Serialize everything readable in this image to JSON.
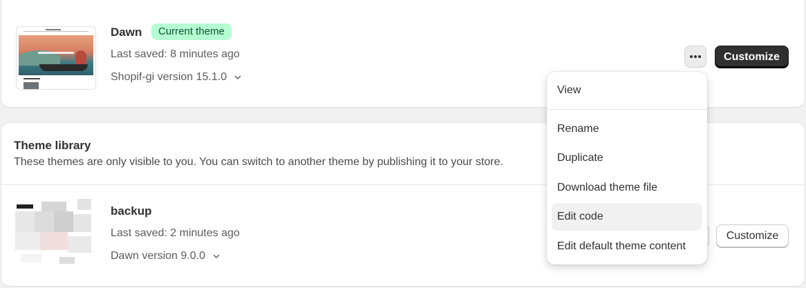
{
  "current_theme": {
    "name": "Dawn",
    "badge": "Current theme",
    "last_saved": "Last saved: 8 minutes ago",
    "version": "Shopif-gi version 15.1.0",
    "actions_icon": "more-horizontal-icon",
    "customize_label": "Customize"
  },
  "theme_library": {
    "title": "Theme library",
    "subtitle": "These themes are only visible to you. You can switch to another theme by publishing it to your store.",
    "themes": [
      {
        "name": "backup",
        "last_saved": "Last saved: 2 minutes ago",
        "version": "Dawn version 9.0.0",
        "customize_label": "Customize"
      }
    ]
  },
  "actions_menu": {
    "items": [
      {
        "label": "View"
      },
      {
        "label": "Rename"
      },
      {
        "label": "Duplicate"
      },
      {
        "label": "Download theme file"
      },
      {
        "label": "Edit code",
        "active": true
      },
      {
        "label": "Edit default theme content"
      }
    ]
  },
  "colors": {
    "badge_bg": "#b4fed2",
    "badge_text": "#0c5132",
    "primary_button": "#303030"
  }
}
